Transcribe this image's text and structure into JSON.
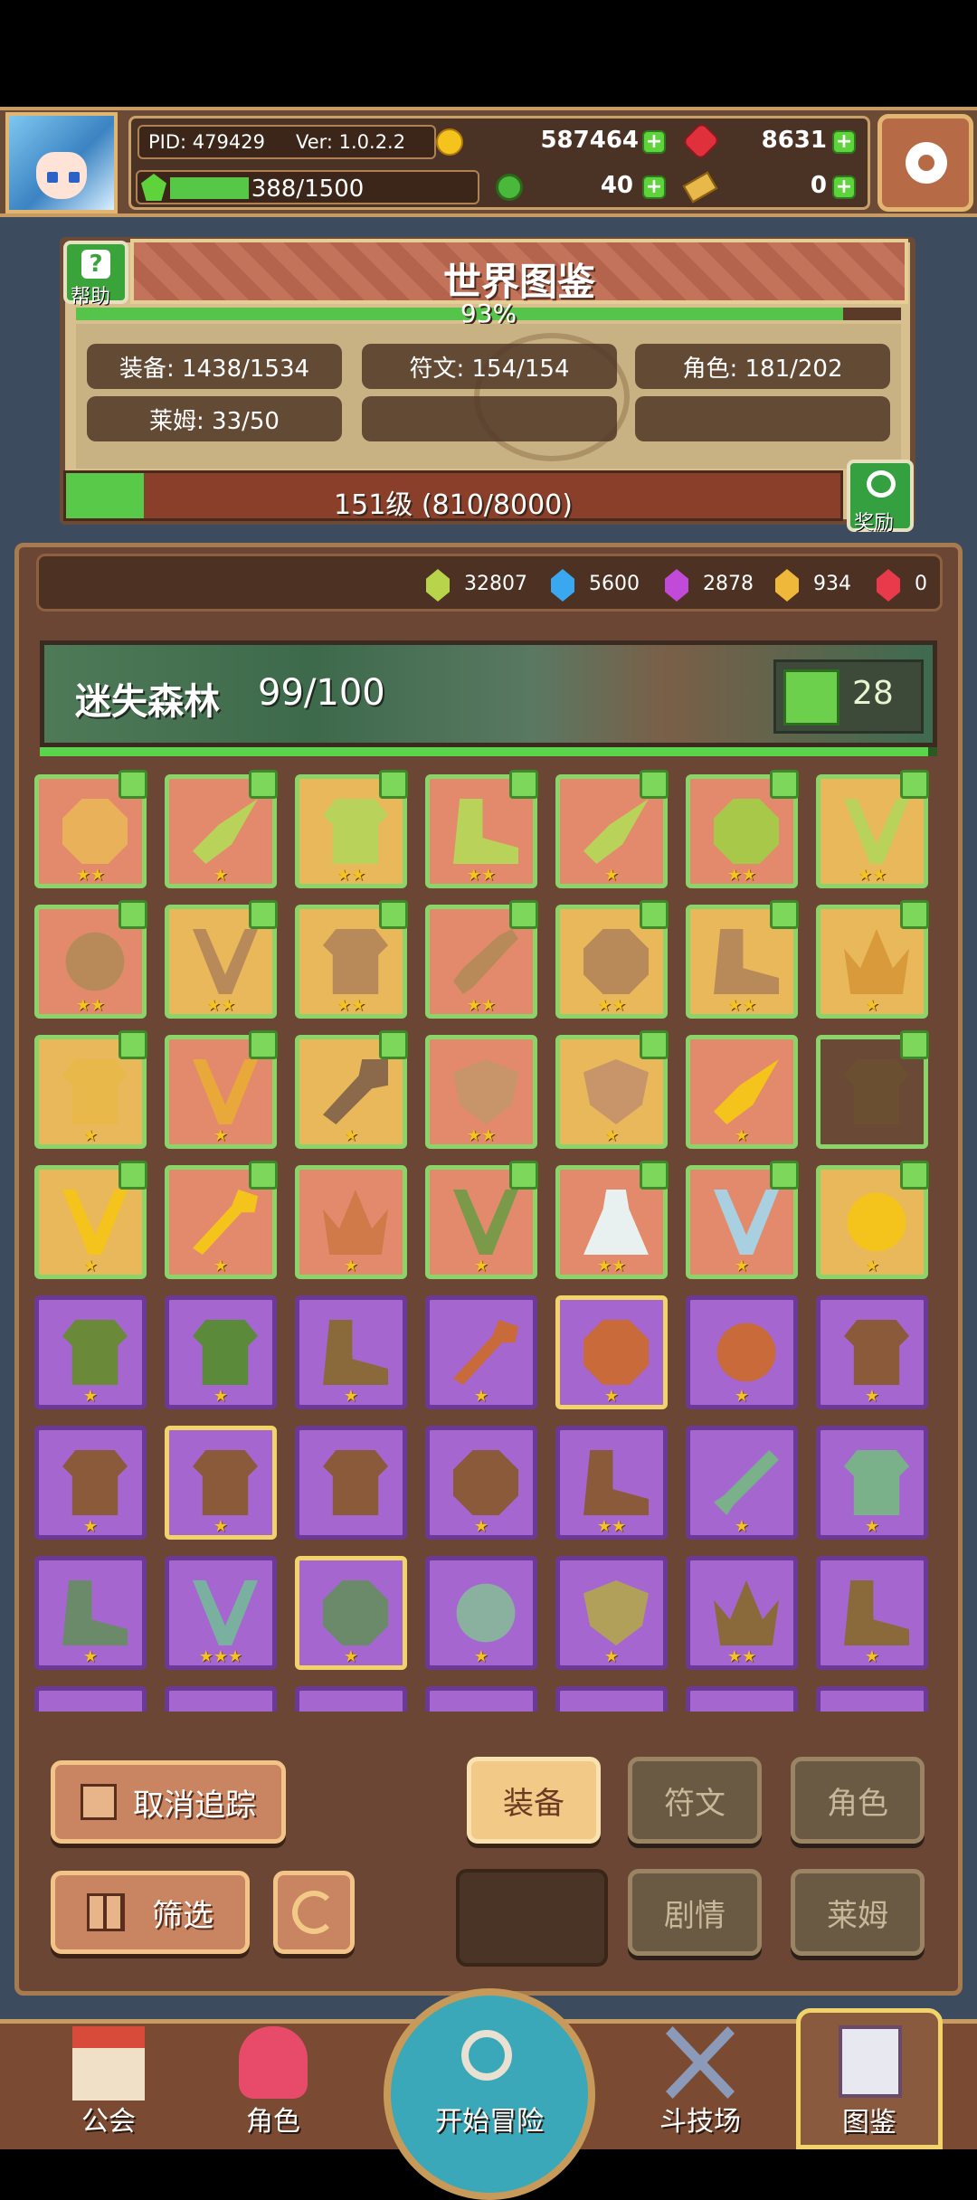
{
  "header": {
    "pid": "PID: 479429",
    "version": "Ver: 1.0.2.2",
    "gold": "587464",
    "ruby": "8631",
    "stamina": "388/1500",
    "stamina_fraction": 0.26,
    "clover": "40",
    "key": "0"
  },
  "world": {
    "title": "世界图鉴",
    "help_label": "帮助",
    "percent": "93%",
    "percent_value": 0.93,
    "stats": {
      "equipment": "装备: 1438/1534",
      "rune": "符文: 154/154",
      "character": "角色: 181/202",
      "slime": "莱姆: 33/50"
    },
    "level_text": "151级 (810/8000)",
    "level_fraction": 0.101,
    "reward_label": "奖励"
  },
  "gems": [
    {
      "color": "#b8d44a",
      "value": "32807"
    },
    {
      "color": "#3aa8f0",
      "value": "5600"
    },
    {
      "color": "#c24ad8",
      "value": "2878"
    },
    {
      "color": "#f0b83a",
      "value": "934"
    },
    {
      "color": "#e83a4a",
      "value": "0"
    }
  ],
  "zone": {
    "name": "迷失森林",
    "count": "99/100",
    "progress": 0.99,
    "likes": "28"
  },
  "grid": [
    [
      [
        "red",
        2,
        1,
        "#e8b15a",
        "ring"
      ],
      [
        "red",
        1,
        1,
        "#b9d35a",
        "leaf"
      ],
      [
        "gold",
        2,
        1,
        "#b9d35a",
        "armor"
      ],
      [
        "red",
        2,
        1,
        "#b9d35a",
        "boots"
      ],
      [
        "red",
        1,
        1,
        "#b9d35a",
        "leaf"
      ],
      [
        "red",
        2,
        1,
        "#a8c84a",
        "ring"
      ],
      [
        "gold",
        2,
        1,
        "#b9d35a",
        "necklace"
      ]
    ],
    [
      [
        "red",
        2,
        1,
        "#b88a5a",
        "orb"
      ],
      [
        "gold",
        2,
        1,
        "#b88a5a",
        "necklace"
      ],
      [
        "gold",
        2,
        1,
        "#b88a5a",
        "armor"
      ],
      [
        "red",
        2,
        1,
        "#b88a5a",
        "bone"
      ],
      [
        "gold",
        2,
        1,
        "#b88a5a",
        "ring"
      ],
      [
        "gold",
        2,
        1,
        "#b88a5a",
        "boots"
      ],
      [
        "gold",
        1,
        1,
        "#d89a3a",
        "crown"
      ]
    ],
    [
      [
        "gold",
        1,
        1,
        "#e8b84a",
        "armor"
      ],
      [
        "red",
        1,
        1,
        "#e8a83a",
        "necklace"
      ],
      [
        "gold",
        1,
        1,
        "#8a6a4a",
        "mace"
      ],
      [
        "red",
        2,
        0,
        "#c8946a",
        "shield"
      ],
      [
        "gold",
        1,
        1,
        "#c8946a",
        "shield"
      ],
      [
        "red",
        1,
        0,
        "#f4c41c",
        "leaf"
      ],
      [
        "brown",
        0,
        1,
        "#6a5030",
        "armor"
      ]
    ],
    [
      [
        "gold",
        1,
        1,
        "#f4c41c",
        "necklace"
      ],
      [
        "red",
        1,
        1,
        "#f4c41c",
        "wand"
      ],
      [
        "red",
        1,
        0,
        "#d07a4a",
        "crown"
      ],
      [
        "red",
        1,
        1,
        "#7a9a4a",
        "necklace"
      ],
      [
        "red",
        2,
        1,
        "#e8f0f0",
        "dress"
      ],
      [
        "red",
        1,
        1,
        "#a8d0e0",
        "necklace"
      ],
      [
        "gold",
        1,
        1,
        "#f4c41c",
        "orb"
      ]
    ],
    [
      [
        "purple",
        1,
        0,
        "#6a8a3a",
        "armor"
      ],
      [
        "purple",
        1,
        0,
        "#5a8a3a",
        "armor"
      ],
      [
        "purple",
        1,
        0,
        "#8a6a3a",
        "boots"
      ],
      [
        "purple",
        1,
        0,
        "#c86a3a",
        "wand"
      ],
      [
        "purple sel",
        1,
        0,
        "#c86a3a",
        "ring"
      ],
      [
        "purple",
        1,
        0,
        "#c86a3a",
        "orb"
      ],
      [
        "purple",
        1,
        0,
        "#8a5a3a",
        "armor"
      ]
    ],
    [
      [
        "purple",
        1,
        0,
        "#8a5a3a",
        "armor"
      ],
      [
        "purple sel",
        1,
        0,
        "#8a5a3a",
        "armor"
      ],
      [
        "purple",
        0,
        0,
        "#8a5a3a",
        "armor"
      ],
      [
        "purple",
        1,
        0,
        "#8a5a3a",
        "ring"
      ],
      [
        "purple",
        2,
        0,
        "#8a5a3a",
        "boots"
      ],
      [
        "purple",
        1,
        0,
        "#7ab08a",
        "sword"
      ],
      [
        "purple",
        1,
        0,
        "#7ab08a",
        "armor"
      ]
    ],
    [
      [
        "purple",
        1,
        0,
        "#6a8a6a",
        "boots"
      ],
      [
        "purple",
        3,
        0,
        "#7ab0a0",
        "necklace"
      ],
      [
        "purple sel",
        1,
        0,
        "#6a8a6a",
        "ring"
      ],
      [
        "purple",
        1,
        0,
        "#8ab0a0",
        "orb"
      ],
      [
        "purple",
        1,
        0,
        "#b0a05a",
        "shield"
      ],
      [
        "purple",
        2,
        0,
        "#8a6a3a",
        "crown"
      ],
      [
        "purple",
        1,
        0,
        "#8a6a3a",
        "boots"
      ]
    ]
  ],
  "controls": {
    "untrack": "取消追踪",
    "filter": "筛选",
    "tab_equipment": "装备",
    "tab_rune": "符文",
    "tab_character": "角色",
    "tab_story": "剧情",
    "tab_slime": "莱姆"
  },
  "nav": {
    "guild": "公会",
    "character": "角色",
    "adventure": "开始冒险",
    "arena": "斗技场",
    "codex": "图鉴"
  }
}
